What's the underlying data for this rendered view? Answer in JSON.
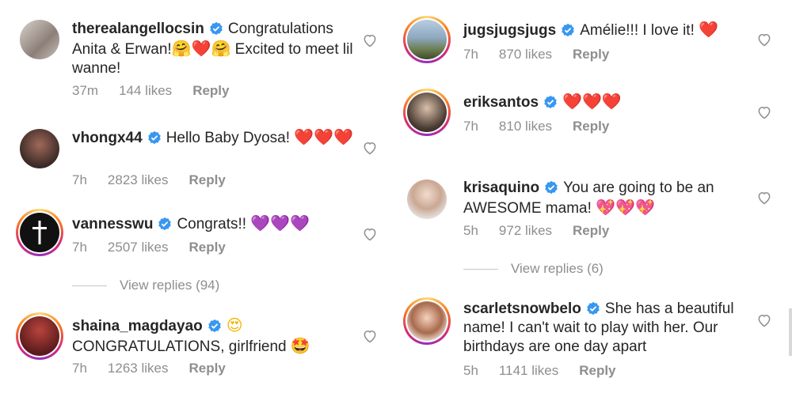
{
  "left": [
    {
      "username": "therealangellocsin",
      "text_parts": [
        "Congratulations Anita & Erwan!",
        "🤗❤️🤗",
        " Excited to meet lil wanne!"
      ],
      "time": "37m",
      "likes": "144 likes",
      "reply": "Reply",
      "ring": false
    },
    {
      "username": "vhongx44",
      "text_parts": [
        "Hello Baby Dyosa! ",
        "❤️❤️❤️"
      ],
      "time": "7h",
      "likes": "2823 likes",
      "reply": "Reply",
      "ring": false
    },
    {
      "username": "vannesswu",
      "text_parts": [
        "Congrats!! ",
        "💜💜💜"
      ],
      "time": "7h",
      "likes": "2507 likes",
      "reply": "Reply",
      "ring": true
    },
    {
      "username": "shaina_magdayao",
      "text_parts": [
        "😍",
        "CONGRATULATIONS, girlfriend ",
        "🤩"
      ],
      "time": "7h",
      "likes": "1263 likes",
      "reply": "Reply",
      "ring": true
    }
  ],
  "left_view_replies": "View replies (94)",
  "right": [
    {
      "username": "jugsjugsjugs",
      "text_parts": [
        "Amélie!!! I love it! ",
        "❤️"
      ],
      "time": "7h",
      "likes": "870 likes",
      "reply": "Reply",
      "ring": true
    },
    {
      "username": "eriksantos",
      "text_parts": [
        "❤️❤️❤️"
      ],
      "time": "7h",
      "likes": "810 likes",
      "reply": "Reply",
      "ring": true
    },
    {
      "username": "krisaquino",
      "text_parts": [
        "You are going to be an AWESOME mama! ",
        "💖💖💖"
      ],
      "time": "5h",
      "likes": "972 likes",
      "reply": "Reply",
      "ring": false
    },
    {
      "username": "scarletsnowbelo",
      "text_parts": [
        "She has a beautiful name! I can't wait to play with her. Our birthdays are one day apart"
      ],
      "time": "5h",
      "likes": "1141 likes",
      "reply": "Reply",
      "ring": true
    }
  ],
  "right_view_replies": "View replies (6)",
  "colors": {
    "verified": "#3897f0",
    "meta": "#8e8e8e",
    "text": "#262626"
  }
}
